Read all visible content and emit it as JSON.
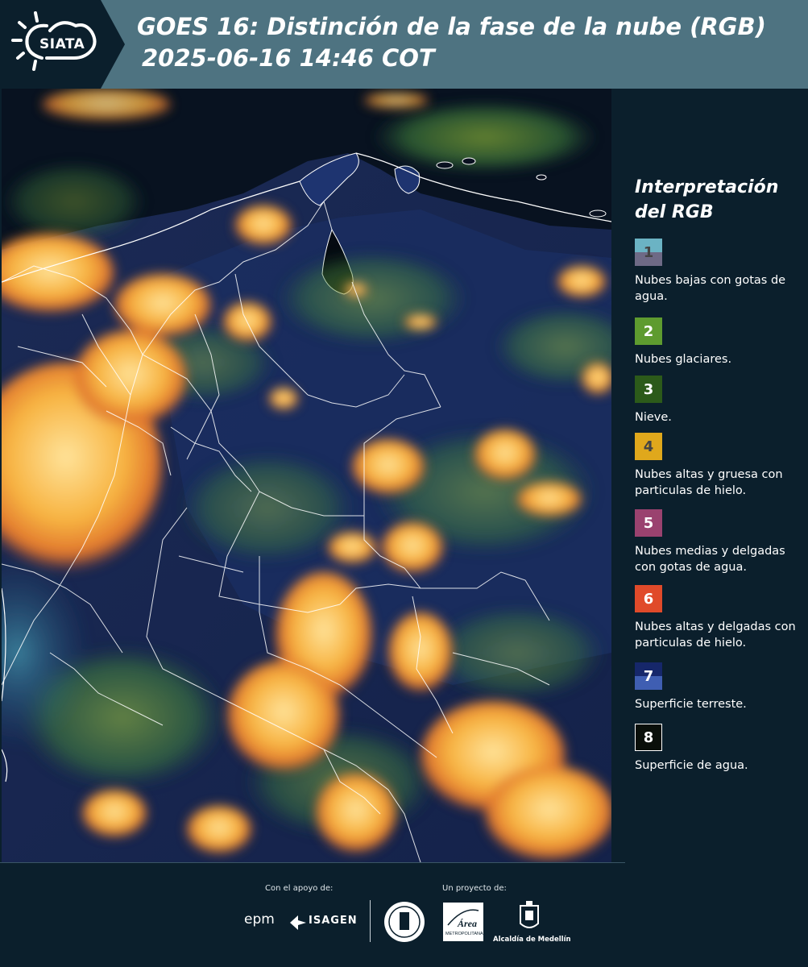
{
  "header": {
    "logo_text": "SIATA",
    "title_line1": "GOES 16: Distinción de la fase de la nube (RGB)",
    "title_line2": "2025-06-16 14:46 COT"
  },
  "legend": {
    "title_line1": "Interpretación",
    "title_line2": "del RGB",
    "items": [
      {
        "num": "1",
        "label": "Nubes bajas con gotas de agua.",
        "color_top": "#6bb3c4",
        "color_bottom": "#6e6a86",
        "num_color": "#444444"
      },
      {
        "num": "2",
        "label": "Nubes glaciares.",
        "color_top": "#5e9b2f",
        "color_bottom": "#5e9b2f",
        "num_color": "#ffffff"
      },
      {
        "num": "3",
        "label": "Nieve.",
        "color_top": "#2c5a1a",
        "color_bottom": "#2c5a1a",
        "num_color": "#ffffff"
      },
      {
        "num": "4",
        "label": "Nubes altas y gruesa con particulas de hielo.",
        "color_top": "#e0a81c",
        "color_bottom": "#e0a81c",
        "num_color": "#444444"
      },
      {
        "num": "5",
        "label": "Nubes medias y delgadas con gotas de agua.",
        "color_top": "#9a426f",
        "color_bottom": "#9a426f",
        "num_color": "#ffffff"
      },
      {
        "num": "6",
        "label": "Nubes altas y delgadas con particulas de hielo.",
        "color_top": "#e04a2a",
        "color_bottom": "#e04a2a",
        "num_color": "#ffffff"
      },
      {
        "num": "7",
        "label": "Superficie terreste.",
        "color_top": "#16276a",
        "color_bottom": "#3f5eb2",
        "num_color": "#ffffff"
      },
      {
        "num": "8",
        "label": "Superficie de agua.",
        "color_top": "#0a0f0a",
        "color_bottom": "#0a0f0a",
        "num_color": "#ffffff"
      }
    ]
  },
  "footer": {
    "support_label": "Con el apoyo de:",
    "project_label": "Un proyecto de:",
    "epm": "epm",
    "isagen": "ISAGEN",
    "alcaldia": "Alcaldía de Medellín",
    "area_word": "Área",
    "area_sub": "METROPOLITANA"
  },
  "colors": {
    "background": "#0b1f2c",
    "header": "#4e7381",
    "border_lines": "#ffffff"
  },
  "icons": [
    "sun-cloud-logo-icon",
    "epm-logo-icon",
    "isagen-logo-icon",
    "seal-icon",
    "area-metropolitana-logo-icon",
    "alcaldia-logo-icon"
  ]
}
